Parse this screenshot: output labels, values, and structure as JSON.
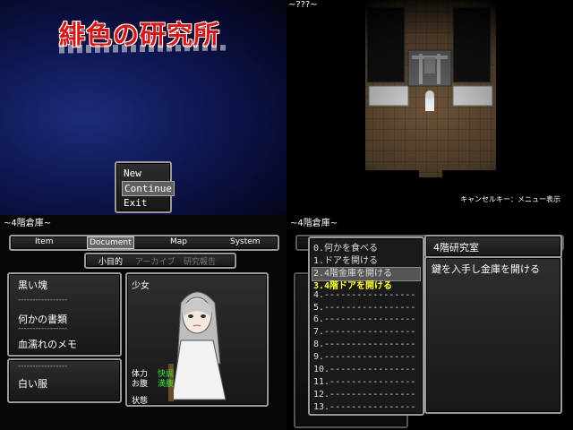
{
  "title_screen": {
    "logo": "緋色の研究所",
    "menu": [
      "New Game",
      "Continue",
      "Exit"
    ],
    "selected": 1
  },
  "map_screen": {
    "location": "~???~",
    "hint": "キャンセルキー：メニュー表示"
  },
  "document_screen": {
    "location": "~4階倉庫~",
    "tabs": [
      "Item",
      "Document",
      "Map",
      "System"
    ],
    "selected_tab": 1,
    "subtabs": [
      "小目的",
      "アーカイブ",
      "研究報告"
    ],
    "left_items": [
      "黒い塊",
      "-----------------",
      "何かの書類",
      "-----------------",
      "血濡れのメモ"
    ],
    "left_items2": [
      "-----------------",
      "白い服"
    ],
    "character": {
      "name": "少女",
      "stats": [
        {
          "label": "体力",
          "value": "快調"
        },
        {
          "label": "お腹",
          "value": "満腹"
        },
        {
          "label": "状態",
          "value": ""
        }
      ]
    }
  },
  "objective_screen": {
    "location": "~4階倉庫~",
    "objectives": [
      "0.何かを食べる",
      "1.ドアを開ける",
      "2.4階金庫を開ける",
      "3.4階ドアを開ける",
      "4.-----------------",
      "5.-----------------",
      "6.-----------------",
      "7.-----------------",
      "8.-----------------",
      "9.-----------------",
      "10.----------------",
      "11.----------------",
      "12.----------------",
      "13.----------------"
    ],
    "highlighted_index": 2,
    "current_index": 3,
    "detail_title": "4階研究室",
    "detail_text": "鍵を入手し金庫を開ける"
  },
  "colors": {
    "accent_red": "#d21818",
    "status_green": "#3fe03f",
    "current_yellow": "#ffff33"
  }
}
